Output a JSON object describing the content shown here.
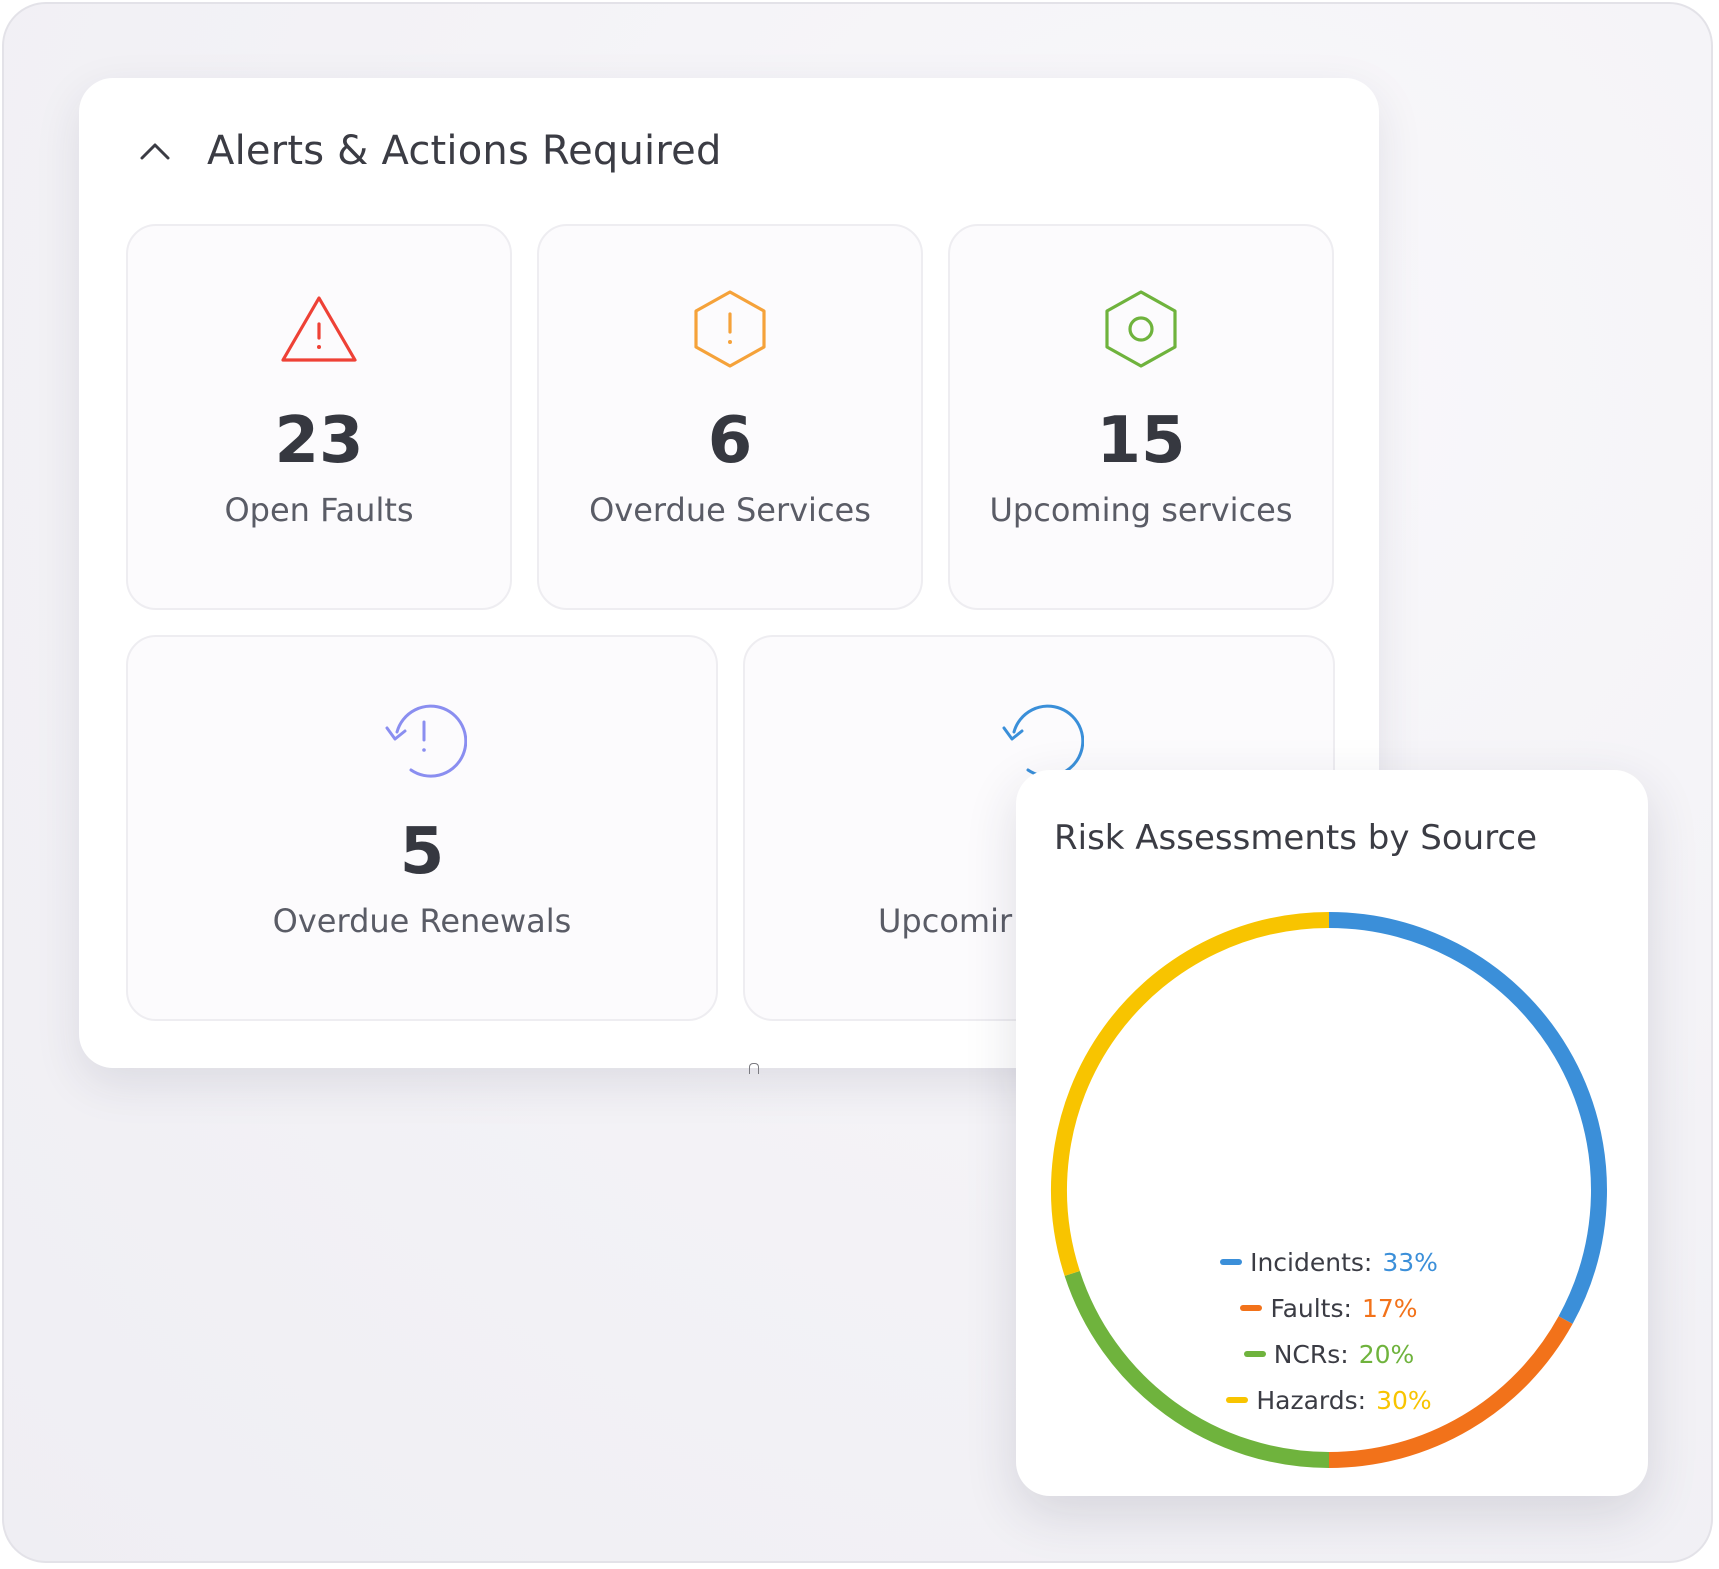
{
  "alerts": {
    "title": "Alerts & Actions Required",
    "collapse_icon": "chevron-up-icon",
    "cards": [
      {
        "count": "23",
        "label": "Open Faults",
        "icon": "warning-triangle-icon",
        "color": "#ee4136"
      },
      {
        "count": "6",
        "label": "Overdue Services",
        "icon": "warning-hexagon-icon",
        "color": "#f5a23a"
      },
      {
        "count": "15",
        "label": "Upcoming services",
        "icon": "hex-nut-icon",
        "color": "#6fb33d"
      },
      {
        "count": "5",
        "label": "Overdue Renewals",
        "icon": "history-alert-icon",
        "color": "#8a8ef0"
      },
      {
        "count": "",
        "label": "Upcomir",
        "icon": "history-icon",
        "color": "#3a8fd9"
      }
    ]
  },
  "risk": {
    "title": "Risk Assessments by Source"
  },
  "chart_data": {
    "type": "pie",
    "title": "Risk Assessments by Source",
    "categories": [
      "Incidents",
      "Faults",
      "NCRs",
      "Hazards"
    ],
    "values": [
      33,
      17,
      20,
      30
    ],
    "value_labels": [
      "33%",
      "17%",
      "20%",
      "30%"
    ],
    "colors": [
      "#3b8fd9",
      "#f2721a",
      "#6fb33d",
      "#f8c400"
    ],
    "legend_placement": "center"
  }
}
